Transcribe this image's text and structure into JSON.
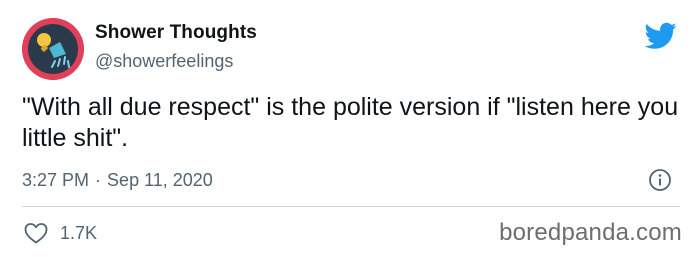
{
  "account": {
    "display_name": "Shower Thoughts",
    "handle": "@showerfeelings",
    "avatar_icon": "lightbulb-shower-icon",
    "avatar_color": "#e0405a"
  },
  "tweet": {
    "text": "\"With all due respect\" is the polite version if \"listen here you little shit\".",
    "time": "3:27 PM",
    "separator": "·",
    "date": "Sep 11, 2020"
  },
  "engagement": {
    "like_icon": "heart-icon",
    "likes": "1.7K"
  },
  "icons": {
    "brand": "twitter-bird-icon",
    "brand_color": "#1d9bf0",
    "info": "info-icon"
  },
  "watermark": "boredpanda.com"
}
